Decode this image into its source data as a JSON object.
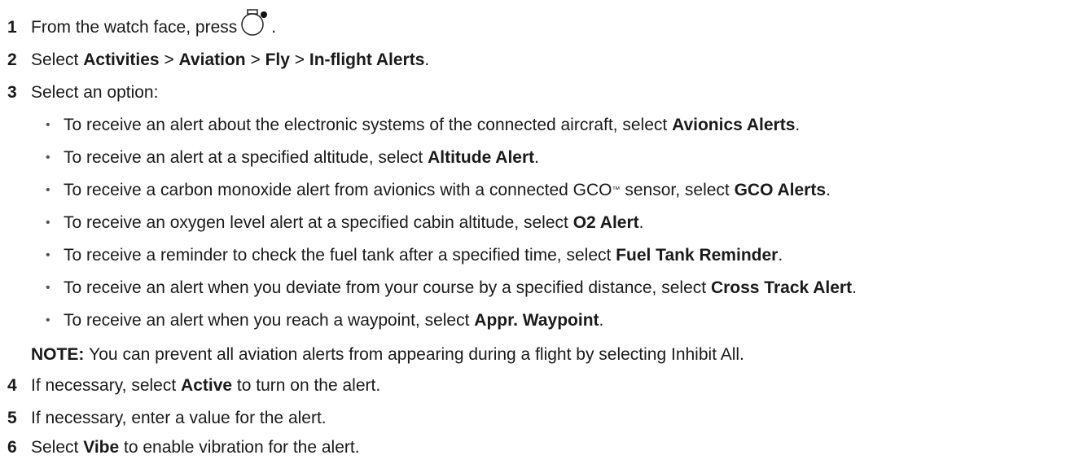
{
  "steps": [
    {
      "num": "1",
      "pre": "From the watch face, press",
      "post": "."
    },
    {
      "num": "2",
      "pre": "Select",
      "a": "Activities",
      "sep1": ">",
      "b": "Aviation",
      "sep2": ">",
      "c": "Fly",
      "sep3": ">",
      "d": "In-flight Alerts",
      "post": "."
    },
    {
      "num": "3",
      "text": "Select an option:"
    },
    {
      "num": "4",
      "pre": "If necessary, select",
      "bold": "Active",
      "post": "to turn on the alert."
    },
    {
      "num": "5",
      "text": "If necessary, enter a value for the alert."
    },
    {
      "num": "6",
      "pre": "Select",
      "bold": "Vibe",
      "post": "to enable vibration for the alert."
    }
  ],
  "options": [
    {
      "pre": "To receive an alert about the electronic systems of the connected aircraft, select",
      "bold": "Avionics Alerts",
      "post": "."
    },
    {
      "pre": "To receive an alert at a specified altitude, select",
      "bold": "Altitude Alert",
      "post": "."
    },
    {
      "pre": "To receive a carbon monoxide alert from avionics with a connected GCO",
      "tm": "™",
      "mid": "sensor, select",
      "bold": "GCO Alerts",
      "post": "."
    },
    {
      "pre": "To receive an oxygen level alert at a specified cabin altitude, select",
      "bold": "O2 Alert",
      "post": "."
    },
    {
      "pre": "To receive a reminder to check the fuel tank after a specified time, select",
      "bold": "Fuel Tank Reminder",
      "post": "."
    },
    {
      "pre": "To receive an alert when you deviate from your course by a specified distance, select",
      "bold": "Cross Track Alert",
      "post": "."
    },
    {
      "pre": "To receive an alert when you reach a waypoint, select",
      "bold": "Appr. Waypoint",
      "post": "."
    }
  ],
  "note": {
    "label": "NOTE:",
    "text": "You can prevent all aviation alerts from appearing during a flight by selecting Inhibit All."
  },
  "bullet_char": "•",
  "icons": {
    "watch_button": "watch-button-icon"
  }
}
